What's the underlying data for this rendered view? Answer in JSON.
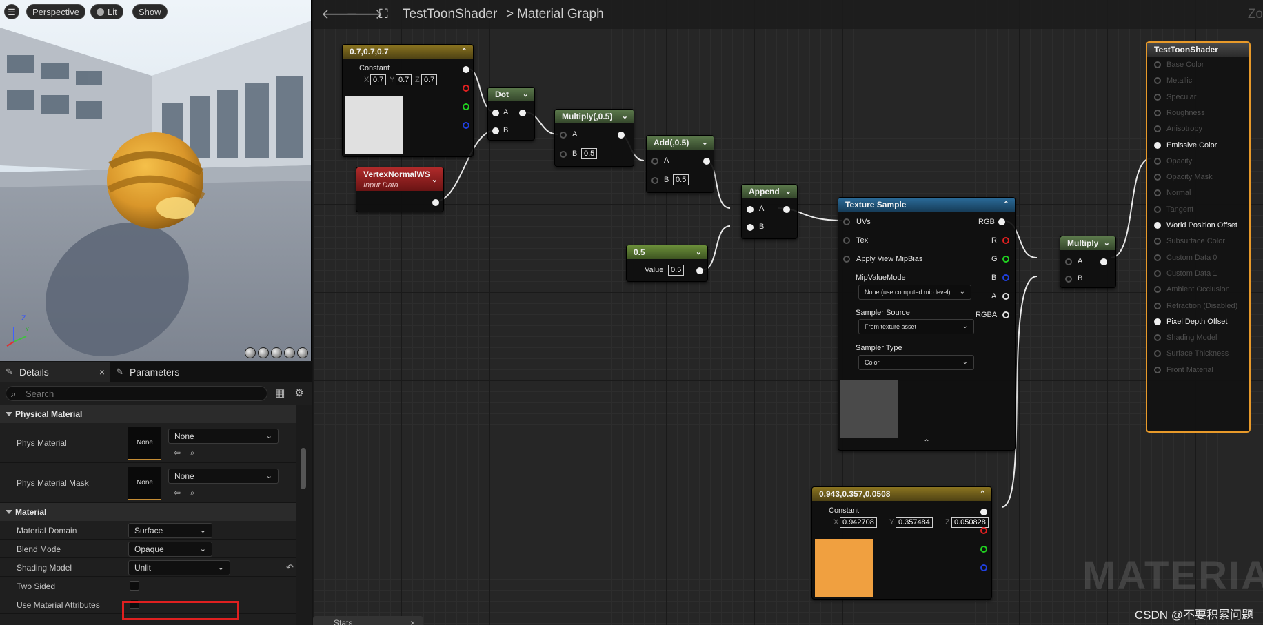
{
  "viewport": {
    "view_mode": "Perspective",
    "lit_mode": "Lit",
    "show_label": "Show",
    "menu_icon": "hamburger-icon",
    "axis_z": "Z",
    "axis_y": "Y"
  },
  "details": {
    "tabs": [
      {
        "label": "Details",
        "icon": "pencil-icon"
      },
      {
        "label": "Parameters",
        "icon": "pencil-icon"
      }
    ],
    "close_glyph": "×",
    "search_placeholder": "Search",
    "categories": {
      "physical": "Physical Material",
      "material": "Material"
    },
    "phys_material": {
      "label": "Phys Material",
      "thumb": "None",
      "value": "None"
    },
    "phys_material_mask": {
      "label": "Phys Material Mask",
      "thumb": "None",
      "value": "None"
    },
    "material_domain": {
      "label": "Material Domain",
      "value": "Surface"
    },
    "blend_mode": {
      "label": "Blend Mode",
      "value": "Opaque"
    },
    "shading_model": {
      "label": "Shading Model",
      "value": "Unlit"
    },
    "two_sided": {
      "label": "Two Sided",
      "checked": false
    },
    "use_material_attributes": {
      "label": "Use Material Attributes",
      "checked": false
    }
  },
  "graph": {
    "breadcrumb": {
      "asset": "TestToonShader",
      "separator": ">",
      "page": "Material Graph"
    },
    "zoom_text": "Zo",
    "watermark": "MATERIA",
    "credit": "CSDN @不要积累问题",
    "stats_tab": "Stats",
    "nodes": {
      "const3": {
        "title": "0.7,0.7,0.7",
        "label": "Constant",
        "x": "0.7",
        "y": "0.7",
        "z": "0.7",
        "swatch": "#e0e0e0"
      },
      "vnormal": {
        "title": "VertexNormalWS",
        "subtitle": "Input Data"
      },
      "dot": {
        "title": "Dot",
        "a": "A",
        "b": "B"
      },
      "mul05": {
        "title": "Multiply(,0.5)",
        "a": "A",
        "b": "B",
        "b_value": "0.5"
      },
      "add05": {
        "title": "Add(,0.5)",
        "a": "A",
        "b": "B",
        "b_value": "0.5"
      },
      "append": {
        "title": "Append",
        "a": "A",
        "b": "B"
      },
      "scalar": {
        "title": "0.5",
        "label": "Value",
        "value": "0.5"
      },
      "texsample": {
        "title": "Texture Sample",
        "inputs": [
          "UVs",
          "Tex",
          "Apply View MipBias"
        ],
        "outputs": [
          "RGB",
          "R",
          "G",
          "B",
          "A",
          "RGBA"
        ],
        "mip_label": "MipValueMode",
        "mip_value": "None (use computed mip level)",
        "sampler_source_label": "Sampler Source",
        "sampler_source_value": "From texture asset",
        "sampler_type_label": "Sampler Type",
        "sampler_type_value": "Color",
        "swatch": "#4a4a4a"
      },
      "multiply": {
        "title": "Multiply",
        "a": "A",
        "b": "B"
      },
      "const_orange": {
        "title": "0.943,0.357,0.0508",
        "label": "Constant",
        "x": "0.942708",
        "y": "0.357484",
        "z": "0.050828",
        "swatch": "#f0a040"
      },
      "result": {
        "title": "TestToonShader",
        "inputs": [
          {
            "label": "Base Color",
            "active": false
          },
          {
            "label": "Metallic",
            "active": false
          },
          {
            "label": "Specular",
            "active": false
          },
          {
            "label": "Roughness",
            "active": false
          },
          {
            "label": "Anisotropy",
            "active": false
          },
          {
            "label": "Emissive Color",
            "active": true
          },
          {
            "label": "Opacity",
            "active": false
          },
          {
            "label": "Opacity Mask",
            "active": false
          },
          {
            "label": "Normal",
            "active": false
          },
          {
            "label": "Tangent",
            "active": false
          },
          {
            "label": "World Position Offset",
            "active": true
          },
          {
            "label": "Subsurface Color",
            "active": false
          },
          {
            "label": "Custom Data 0",
            "active": false
          },
          {
            "label": "Custom Data 1",
            "active": false
          },
          {
            "label": "Ambient Occlusion",
            "active": false
          },
          {
            "label": "Refraction (Disabled)",
            "active": false
          },
          {
            "label": "Pixel Depth Offset",
            "active": true
          },
          {
            "label": "Shading Model",
            "active": false
          },
          {
            "label": "Surface Thickness",
            "active": false
          },
          {
            "label": "Front Material",
            "active": false
          }
        ]
      }
    }
  },
  "colors": {
    "accent_orange": "#e89a2a",
    "highlight_red": "#e02020"
  }
}
